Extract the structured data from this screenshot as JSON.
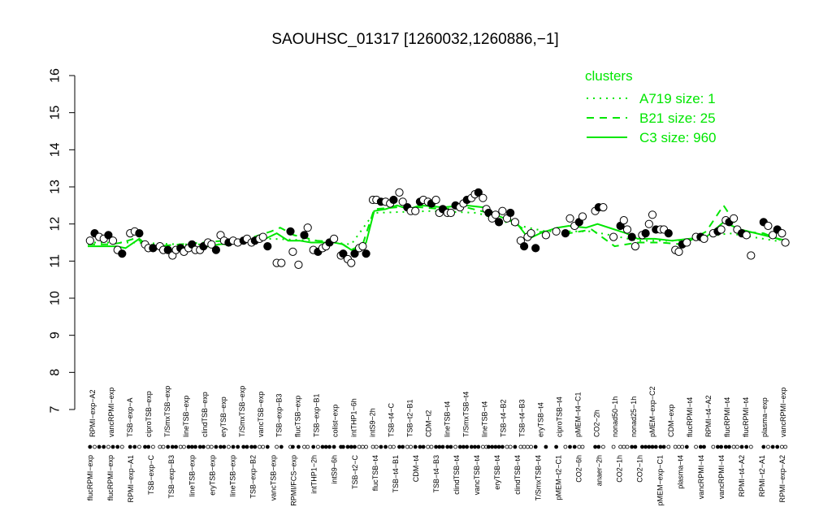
{
  "chart_data": {
    "type": "line",
    "title": "SAOUHSC_01317 [1260032,1260886,−1]",
    "xlabel": "",
    "ylabel": "",
    "ylim": [
      7,
      16
    ],
    "yticks": [
      7,
      8,
      9,
      10,
      11,
      12,
      13,
      14,
      15,
      16
    ],
    "grid": false,
    "legend_title": "clusters",
    "legend_position": "top-right",
    "legend": [
      {
        "label": "A719 size: 1",
        "style": "dotted",
        "color": "#00e600"
      },
      {
        "label": "B21 size: 25",
        "style": "dashed",
        "color": "#00e600"
      },
      {
        "label": "C3 size: 960",
        "style": "solid",
        "color": "#00e600"
      }
    ],
    "labels_top": [
      "RPMI−exp−A2",
      "vancRPMI−exp",
      "TSB−exp−A",
      "ciproTSB−exp",
      "T/SmxTSB−exp",
      "lineTSB−exp",
      "clindTSB−exp",
      "eryTSB−exp",
      "T/SmxTSB−exp",
      "vancTSB−exp",
      "TSB−exp−B3",
      "flucTSB−exp",
      "TSB−exp−B1",
      "colist−exp",
      "intTHP1−6h",
      "intS9−2h",
      "TSB−t4−C",
      "TSB−t2−B1",
      "CDM−t2",
      "lineTSB−t4",
      "T/SmxTSB−t4",
      "lineTSB−t4",
      "TSB−t4−B2",
      "TSB−t4−B3",
      "eryTSB−t4",
      "ciproTSB−t4",
      "pMEM−t4−C1",
      "CO2−2h",
      "nonad50−1h",
      "nonad25−1h",
      "pMEM−exp−C2",
      "CDM−exp",
      "flucRPMI−t4",
      "RPMI−t4−A2",
      "flucRPMI−t4",
      "flucRPMI−t4",
      "plasma−exp",
      "vancRPMI−exp"
    ],
    "labels_bottom": [
      "flucRPMI−exp",
      "flucRPMI−exp",
      "RPMI−exp−A1",
      "TSB−exp−C",
      "TSB−exp−B3",
      "lineTSB−exp",
      "eryTSB−exp",
      "lineTSB−exp",
      "TSB−exp−B2",
      "vancTSB−exp",
      "RPMI/FCS−exp",
      "intTHP1−2h",
      "intS9−6h",
      "TSB−t2−C",
      "flucTSB−t4",
      "TSB−t4−B1",
      "CDM−t4",
      "TSB−t4−B3",
      "clindTSB−t4",
      "vancTSB−t4",
      "eryTSB−t4",
      "clindTSB−t4",
      "T/SmxTSB−t4",
      "pMEM−t2−C1",
      "CO2−6h",
      "anaer−2h",
      "CO2−1h",
      "CO2−1h",
      "pMEM−exp−C1",
      "plasma−t4",
      "vancRPMI−t4",
      "vancRPMI−t4",
      "RPMI−t4−A2",
      "RPMI−t2−A1",
      "RPMI−exp−A2"
    ],
    "points": [
      [
        0.2,
        11.55
      ],
      [
        0.6,
        11.75
      ],
      [
        1.0,
        11.65
      ],
      [
        1.4,
        11.6
      ],
      [
        1.8,
        11.7
      ],
      [
        2.2,
        11.55
      ],
      [
        2.6,
        11.3
      ],
      [
        3.0,
        11.2
      ],
      [
        3.7,
        11.75
      ],
      [
        4.1,
        11.8
      ],
      [
        4.5,
        11.75
      ],
      [
        5.0,
        11.45
      ],
      [
        5.3,
        11.35
      ],
      [
        5.7,
        11.35
      ],
      [
        6.3,
        11.4
      ],
      [
        6.6,
        11.3
      ],
      [
        7.0,
        11.3
      ],
      [
        7.4,
        11.15
      ],
      [
        7.7,
        11.3
      ],
      [
        8.1,
        11.35
      ],
      [
        8.4,
        11.25
      ],
      [
        8.8,
        11.35
      ],
      [
        9.1,
        11.45
      ],
      [
        9.4,
        11.3
      ],
      [
        9.8,
        11.3
      ],
      [
        10.1,
        11.4
      ],
      [
        10.5,
        11.5
      ],
      [
        10.8,
        11.45
      ],
      [
        11.2,
        11.3
      ],
      [
        11.6,
        11.7
      ],
      [
        11.9,
        11.55
      ],
      [
        12.3,
        11.5
      ],
      [
        12.7,
        11.55
      ],
      [
        13.1,
        11.5
      ],
      [
        13.6,
        11.55
      ],
      [
        13.9,
        11.6
      ],
      [
        14.3,
        11.5
      ],
      [
        14.6,
        11.55
      ],
      [
        15.0,
        11.6
      ],
      [
        15.3,
        11.65
      ],
      [
        15.7,
        11.4
      ],
      [
        16.5,
        10.95
      ],
      [
        16.9,
        10.95
      ],
      [
        17.7,
        11.8
      ],
      [
        17.9,
        11.25
      ],
      [
        18.4,
        10.9
      ],
      [
        18.9,
        11.7
      ],
      [
        19.2,
        11.9
      ],
      [
        19.7,
        11.3
      ],
      [
        20.1,
        11.25
      ],
      [
        20.5,
        11.35
      ],
      [
        20.8,
        11.4
      ],
      [
        21.1,
        11.5
      ],
      [
        21.5,
        11.6
      ],
      [
        22.1,
        11.15
      ],
      [
        22.3,
        11.2
      ],
      [
        22.7,
        11.05
      ],
      [
        23.0,
        10.95
      ],
      [
        23.3,
        11.2
      ],
      [
        23.7,
        11.35
      ],
      [
        24.0,
        11.4
      ],
      [
        24.3,
        11.2
      ],
      [
        24.9,
        12.65
      ],
      [
        25.2,
        12.65
      ],
      [
        25.6,
        12.6
      ],
      [
        26.0,
        12.6
      ],
      [
        26.4,
        12.55
      ],
      [
        26.7,
        12.65
      ],
      [
        27.2,
        12.85
      ],
      [
        27.5,
        12.6
      ],
      [
        27.9,
        12.45
      ],
      [
        28.2,
        12.35
      ],
      [
        28.6,
        12.35
      ],
      [
        29.0,
        12.6
      ],
      [
        29.3,
        12.65
      ],
      [
        29.7,
        12.6
      ],
      [
        30.0,
        12.55
      ],
      [
        30.4,
        12.65
      ],
      [
        30.7,
        12.3
      ],
      [
        31.0,
        12.4
      ],
      [
        31.4,
        12.3
      ],
      [
        31.7,
        12.3
      ],
      [
        32.1,
        12.5
      ],
      [
        32.5,
        12.45
      ],
      [
        32.8,
        12.55
      ],
      [
        33.1,
        12.65
      ],
      [
        33.5,
        12.7
      ],
      [
        33.8,
        12.8
      ],
      [
        34.1,
        12.85
      ],
      [
        34.5,
        12.7
      ],
      [
        34.8,
        12.4
      ],
      [
        35.0,
        12.3
      ],
      [
        35.3,
        12.15
      ],
      [
        35.6,
        12.25
      ],
      [
        35.9,
        12.05
      ],
      [
        36.2,
        12.35
      ],
      [
        36.6,
        12.15
      ],
      [
        36.9,
        12.3
      ],
      [
        37.3,
        12.05
      ],
      [
        37.8,
        11.55
      ],
      [
        38.1,
        11.4
      ],
      [
        38.4,
        11.65
      ],
      [
        38.7,
        11.75
      ],
      [
        39.1,
        11.35
      ],
      [
        40.0,
        11.7
      ],
      [
        40.9,
        11.8
      ],
      [
        41.7,
        11.75
      ],
      [
        42.1,
        12.15
      ],
      [
        42.5,
        11.95
      ],
      [
        42.9,
        12.05
      ],
      [
        43.2,
        12.2
      ],
      [
        44.3,
        12.35
      ],
      [
        44.6,
        12.45
      ],
      [
        45.0,
        12.45
      ],
      [
        45.9,
        11.65
      ],
      [
        46.5,
        11.95
      ],
      [
        46.8,
        12.1
      ],
      [
        47.1,
        11.85
      ],
      [
        47.5,
        11.65
      ],
      [
        47.8,
        11.4
      ],
      [
        48.4,
        11.7
      ],
      [
        48.7,
        11.75
      ],
      [
        49.0,
        12.0
      ],
      [
        49.3,
        12.25
      ],
      [
        49.6,
        11.85
      ],
      [
        50.0,
        11.85
      ],
      [
        50.3,
        11.85
      ],
      [
        50.7,
        11.75
      ],
      [
        51.3,
        11.3
      ],
      [
        51.6,
        11.25
      ],
      [
        51.9,
        11.45
      ],
      [
        52.3,
        11.5
      ],
      [
        53.1,
        11.65
      ],
      [
        53.5,
        11.65
      ],
      [
        53.8,
        11.6
      ],
      [
        54.6,
        11.75
      ],
      [
        55.0,
        11.8
      ],
      [
        55.3,
        11.85
      ],
      [
        55.7,
        12.1
      ],
      [
        56.0,
        12.05
      ],
      [
        56.4,
        12.15
      ],
      [
        56.7,
        11.85
      ],
      [
        57.1,
        11.75
      ],
      [
        57.5,
        11.7
      ],
      [
        57.9,
        11.15
      ],
      [
        59.0,
        12.05
      ],
      [
        59.4,
        11.95
      ],
      [
        59.8,
        11.7
      ],
      [
        60.2,
        11.85
      ],
      [
        60.6,
        11.75
      ],
      [
        60.9,
        11.5
      ]
    ],
    "series": [
      {
        "style": "solid",
        "color": "#00e600",
        "values": [
          [
            0,
            11.4
          ],
          [
            1.5,
            11.4
          ],
          [
            2.5,
            11.4
          ],
          [
            3.3,
            11.35
          ],
          [
            4.5,
            11.6
          ],
          [
            5.5,
            11.35
          ],
          [
            7.5,
            11.3
          ],
          [
            9.5,
            11.35
          ],
          [
            11.5,
            11.45
          ],
          [
            13.5,
            11.5
          ],
          [
            15.5,
            11.6
          ],
          [
            16.5,
            11.75
          ],
          [
            17.5,
            11.55
          ],
          [
            18.5,
            11.55
          ],
          [
            19.5,
            11.5
          ],
          [
            21.5,
            11.5
          ],
          [
            22.3,
            11.45
          ],
          [
            23.0,
            11.3
          ],
          [
            23.7,
            11.35
          ],
          [
            24.3,
            11.5
          ],
          [
            25.0,
            12.35
          ],
          [
            26.0,
            12.4
          ],
          [
            27.0,
            12.5
          ],
          [
            28.0,
            12.4
          ],
          [
            29.0,
            12.5
          ],
          [
            31.0,
            12.45
          ],
          [
            33.0,
            12.5
          ],
          [
            34.5,
            12.45
          ],
          [
            36.0,
            12.2
          ],
          [
            37.5,
            12.0
          ],
          [
            38.5,
            11.6
          ],
          [
            39.5,
            11.75
          ],
          [
            41.0,
            11.9
          ],
          [
            42.0,
            11.95
          ],
          [
            43.5,
            11.9
          ],
          [
            44.5,
            12.0
          ],
          [
            46.0,
            11.85
          ],
          [
            47.0,
            11.75
          ],
          [
            48.0,
            11.6
          ],
          [
            49.5,
            11.6
          ],
          [
            51.0,
            11.55
          ],
          [
            52.5,
            11.6
          ],
          [
            54.0,
            11.65
          ],
          [
            55.5,
            12.05
          ],
          [
            57.0,
            11.85
          ],
          [
            59.0,
            11.7
          ],
          [
            61.0,
            11.55
          ]
        ]
      },
      {
        "style": "dashed",
        "color": "#00e600",
        "values": [
          [
            0,
            11.45
          ],
          [
            2,
            11.45
          ],
          [
            3,
            11.5
          ],
          [
            4,
            11.6
          ],
          [
            6,
            11.4
          ],
          [
            8,
            11.45
          ],
          [
            10,
            11.5
          ],
          [
            12,
            11.55
          ],
          [
            14,
            11.6
          ],
          [
            16,
            11.8
          ],
          [
            16.8,
            11.9
          ],
          [
            18,
            11.7
          ],
          [
            20,
            11.55
          ],
          [
            22,
            11.5
          ],
          [
            23,
            11.3
          ],
          [
            24,
            11.45
          ],
          [
            25,
            12.4
          ],
          [
            27,
            12.45
          ],
          [
            29,
            12.45
          ],
          [
            31,
            12.4
          ],
          [
            33,
            12.45
          ],
          [
            35,
            12.3
          ],
          [
            37,
            12.1
          ],
          [
            38.5,
            11.75
          ],
          [
            40,
            11.8
          ],
          [
            42,
            11.75
          ],
          [
            44,
            11.85
          ],
          [
            46,
            11.4
          ],
          [
            48,
            11.5
          ],
          [
            50,
            11.5
          ],
          [
            52,
            11.45
          ],
          [
            54,
            11.8
          ],
          [
            55.5,
            12.5
          ],
          [
            57,
            11.8
          ],
          [
            59,
            11.75
          ],
          [
            61,
            11.5
          ]
        ]
      },
      {
        "style": "dotted",
        "color": "#00e600",
        "values": [
          [
            0,
            11.5
          ],
          [
            4,
            11.5
          ],
          [
            8,
            11.45
          ],
          [
            12,
            11.45
          ],
          [
            16,
            11.6
          ],
          [
            20,
            11.55
          ],
          [
            23,
            11.45
          ],
          [
            25,
            12.3
          ],
          [
            30,
            12.35
          ],
          [
            34,
            12.3
          ],
          [
            37,
            12.0
          ],
          [
            40,
            11.8
          ],
          [
            44,
            11.8
          ],
          [
            48,
            11.55
          ],
          [
            52,
            11.55
          ],
          [
            56,
            11.75
          ],
          [
            61,
            11.5
          ]
        ]
      }
    ]
  }
}
